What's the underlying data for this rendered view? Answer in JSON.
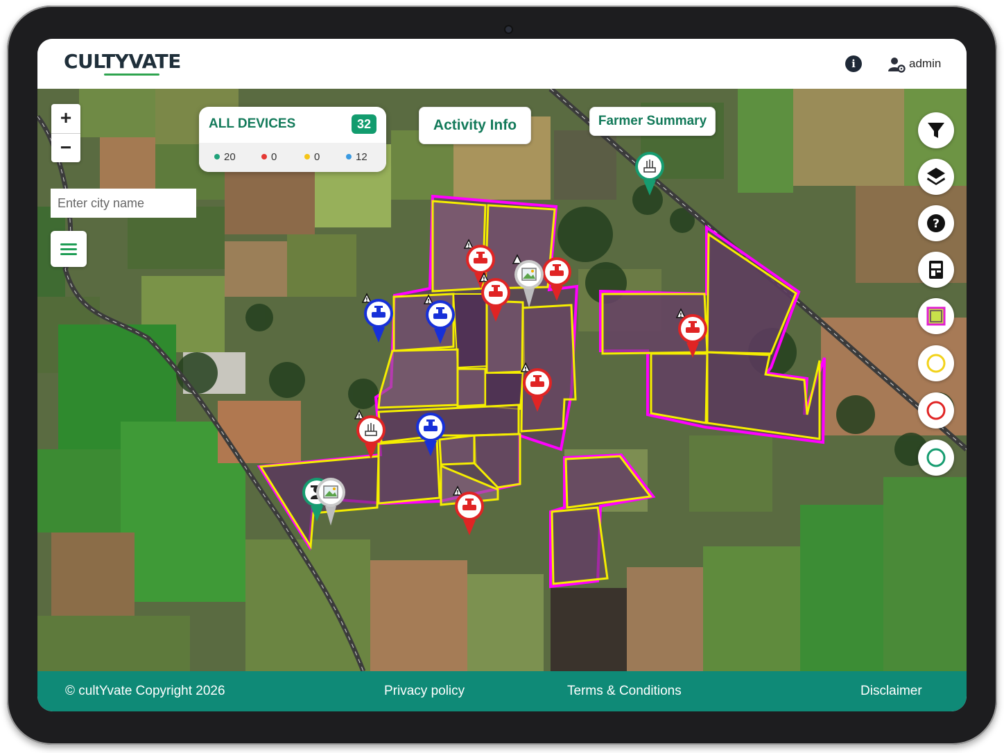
{
  "app": {
    "logo_text": "CULTYVATE"
  },
  "header": {
    "info_icon": "info-icon",
    "user_icon": "user-gear-icon",
    "user_name": "admin"
  },
  "map": {
    "zoom_in_label": "+",
    "zoom_out_label": "−",
    "city_search": {
      "placeholder": "Enter city name",
      "value": ""
    },
    "devices": {
      "title": "ALL DEVICES",
      "total": "32",
      "stats": [
        {
          "color": "#20a27a",
          "count": "20"
        },
        {
          "color": "#e53935",
          "count": "0"
        },
        {
          "color": "#f5c518",
          "count": "0"
        },
        {
          "color": "#3b9ae1",
          "count": "12"
        }
      ]
    },
    "activity_button": "Activity Info",
    "farmer_summary_button": "Farmer Summary",
    "tools": [
      {
        "name": "filter-icon"
      },
      {
        "name": "layers-icon"
      },
      {
        "name": "help-icon"
      },
      {
        "name": "report-icon"
      },
      {
        "name": "polygon-select-icon",
        "border": "#e11fd0",
        "fill": "#c8e04a"
      },
      {
        "name": "yellow-ring-icon",
        "color": "#f2d21a"
      },
      {
        "name": "red-ring-icon",
        "color": "#e02424"
      },
      {
        "name": "green-ring-icon",
        "color": "#169c70"
      }
    ],
    "colors": {
      "field_border_outer": "#ff00ff",
      "field_border_inner": "#f5ee00",
      "valve_red": "#e02424",
      "valve_blue": "#1730d8"
    }
  },
  "footer": {
    "copyright": "© cultYvate Copyright 2026",
    "privacy": "Privacy policy",
    "terms": "Terms & Conditions",
    "disclaimer": "Disclaimer"
  }
}
